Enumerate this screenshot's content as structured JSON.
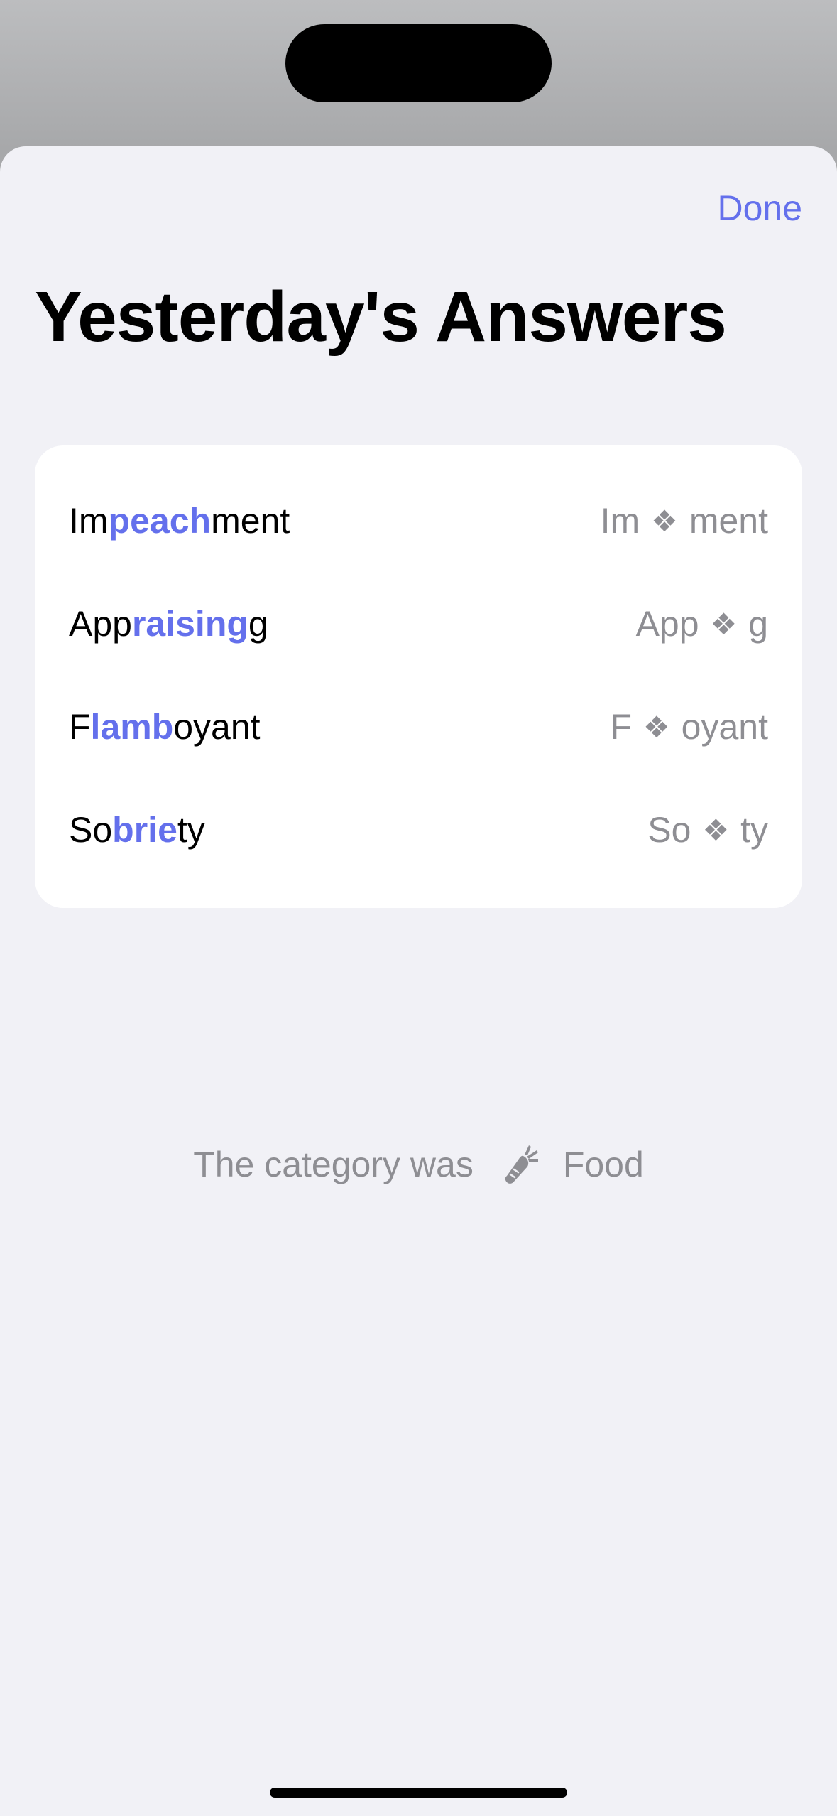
{
  "sheet": {
    "done_label": "Done",
    "title": "Yesterday's Answers"
  },
  "answers": [
    {
      "prefix": "Im",
      "highlight": "peach",
      "suffix": "ment",
      "clue_start": "Im",
      "clue_symbol": "❖",
      "clue_end": "ment"
    },
    {
      "prefix": "App",
      "highlight": "raising",
      "suffix": "g",
      "clue_start": "App",
      "clue_symbol": "❖",
      "clue_end": "g"
    },
    {
      "prefix": "F",
      "highlight": "lamb",
      "suffix": "oyant",
      "clue_start": "F",
      "clue_symbol": "❖",
      "clue_end": "oyant"
    },
    {
      "prefix": "So",
      "highlight": "brie",
      "suffix": "ty",
      "clue_start": "So",
      "clue_symbol": "❖",
      "clue_end": "ty"
    }
  ],
  "category": {
    "prefix_text": "The category was",
    "icon": "carrot-icon",
    "name": "Food"
  },
  "colors": {
    "accent": "#6470ec",
    "secondary_text": "#8e8e93",
    "sheet_background": "#f1f1f6",
    "card_background": "#ffffff"
  }
}
